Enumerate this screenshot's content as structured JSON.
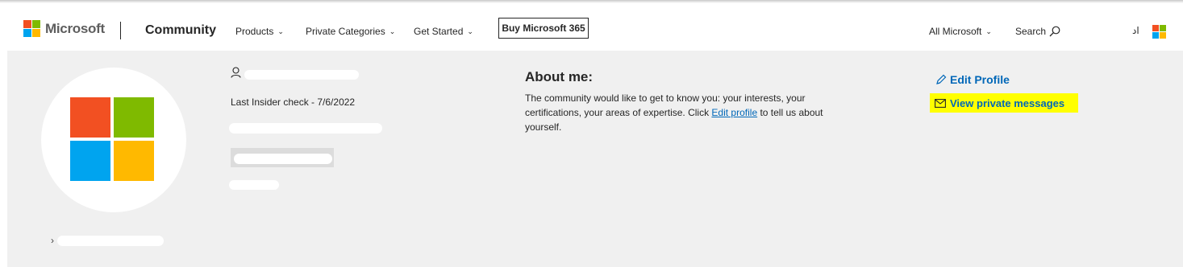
{
  "header": {
    "brand": "Microsoft",
    "site": "Community",
    "nav": [
      {
        "label": "Products"
      },
      {
        "label": "Private Categories"
      },
      {
        "label": "Get Started"
      }
    ],
    "cta": "Buy Microsoft 365",
    "all_microsoft": "All Microsoft",
    "search_label": "Search",
    "user_initial": "اد"
  },
  "profile": {
    "insider_check": "Last Insider check - 7/6/2022",
    "about_title": "About me:",
    "about_text_before": "The community would like to get to know you: your interests, your certifications, your areas of expertise. Click ",
    "about_link": "Edit profile",
    "about_text_after": " to tell us about yourself.",
    "edit_profile": "Edit Profile",
    "view_messages": "View private messages"
  },
  "colors": {
    "ms_red": "#f25022",
    "ms_green": "#7fba00",
    "ms_blue": "#00a4ef",
    "ms_yellow": "#ffb900",
    "link": "#0067b8",
    "highlight": "#ffff00"
  }
}
